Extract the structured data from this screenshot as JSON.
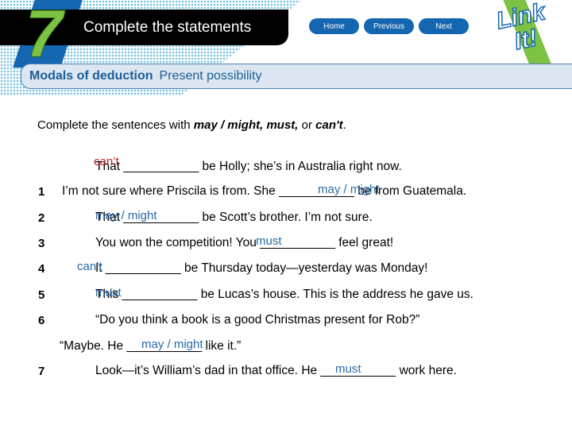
{
  "header": {
    "unit_number": "7",
    "title": "Complete the statements",
    "nav": [
      "Home",
      "Previous",
      "Next"
    ],
    "logo_text": "Link It!"
  },
  "subtitle": {
    "bold": "Modals of deduction",
    "normal": "Present possibility"
  },
  "instruction": {
    "pre": "Complete the sentences with ",
    "words": "may / might, must,",
    "mid": " or ",
    "last": "can't",
    "end": "."
  },
  "colors": {
    "accent": "#1466b0",
    "answer": "#2a6aa5",
    "example_answer": "#c0282a"
  },
  "example": {
    "text": "That ___________ be Holly; she’s in Australia right now.",
    "answer": "can’t"
  },
  "items": [
    {
      "num": "1",
      "text": "I’m not sure where Priscila is from. She ___________ be from Guatemala.",
      "answer": "may / might"
    },
    {
      "num": "2",
      "text": "That ___________ be Scott’s brother. I’m not sure.",
      "answer": "may / might"
    },
    {
      "num": "3",
      "text": "You won the competition! You ___________ feel great!",
      "answer": "must"
    },
    {
      "num": "4",
      "text": "It ___________ be Thursday today—yesterday was Monday!",
      "answer": "can’t"
    },
    {
      "num": "5",
      "text": "This ___________ be Lucas’s house. This is the address he gave us.",
      "answer": "must"
    },
    {
      "num": "6",
      "text": "“Do you think a book is a good Christmas present for Rob?”",
      "text2": "“Maybe. He ___________ like it.”",
      "answer": "may / might"
    },
    {
      "num": "7",
      "text": "Look—it’s William’s dad in that office. He ___________ work here.",
      "answer": "must"
    }
  ]
}
